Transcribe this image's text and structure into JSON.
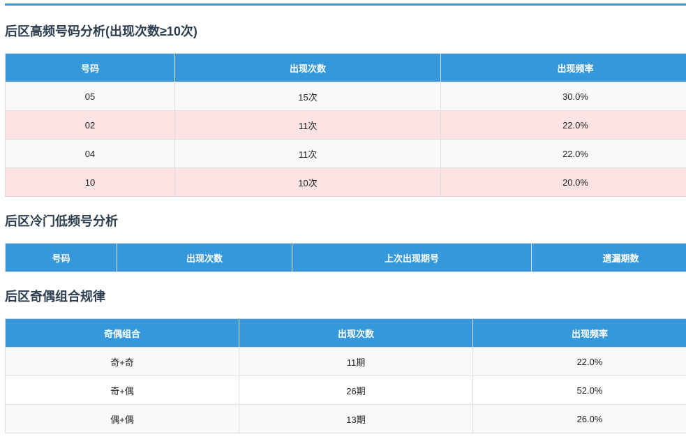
{
  "sections": {
    "high": {
      "title": "后区高频号码分析(出现次数≥10次)",
      "headers": [
        "号码",
        "出现次数",
        "出现频率"
      ],
      "rows": [
        [
          "05",
          "15次",
          "30.0%"
        ],
        [
          "02",
          "11次",
          "22.0%"
        ],
        [
          "04",
          "11次",
          "22.0%"
        ],
        [
          "10",
          "10次",
          "20.0%"
        ]
      ]
    },
    "cold": {
      "title": "后区冷门低频号分析",
      "headers": [
        "号码",
        "出现次数",
        "上次出现期号",
        "遗漏期数"
      ]
    },
    "parity": {
      "title": "后区奇偶组合规律",
      "headers": [
        "奇偶组合",
        "出现次数",
        "出现频率"
      ],
      "rows": [
        [
          "奇+奇",
          "11期",
          "22.0%"
        ],
        [
          "奇+偶",
          "26期",
          "52.0%"
        ],
        [
          "偶+偶",
          "13期",
          "26.0%"
        ]
      ]
    }
  },
  "colors": {
    "header": "#3498db",
    "highlight_row": "#fde3e3",
    "title": "#2c3e50"
  }
}
